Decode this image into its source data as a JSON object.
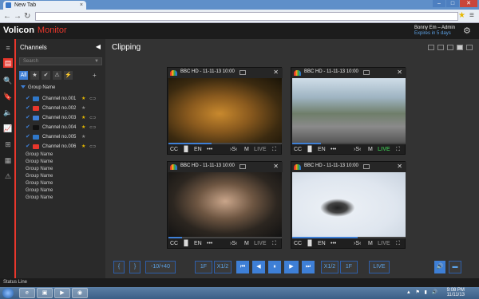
{
  "browser": {
    "tab_title": "New Tab",
    "tab_close": "×",
    "win_min": "–",
    "win_max": "□",
    "win_close": "✕",
    "back": "←",
    "forward": "→",
    "reload": "↻",
    "star_icon": "★",
    "menu_icon": "≡",
    "url": ""
  },
  "app": {
    "brand": "Volicon",
    "product": "Monitor",
    "user_name": "Bonny Em – Admin",
    "user_expiry": "Expires in 5 days",
    "settings_icon": "gear-icon",
    "accent": "#e8372c",
    "blue": "#3e7fd6"
  },
  "leftbar": {
    "items": [
      {
        "icon": "≡"
      },
      {
        "icon": "▤"
      },
      {
        "icon": "🔍"
      },
      {
        "icon": "🔖"
      },
      {
        "icon": "🔈"
      },
      {
        "icon": "📈"
      },
      {
        "icon": "⊞"
      },
      {
        "icon": "▦"
      },
      {
        "icon": "⚠"
      }
    ]
  },
  "channels": {
    "title": "Channels",
    "collapse": "◀",
    "search_placeholder": "Search",
    "filter_icon": "▼",
    "filters": [
      "All",
      "★",
      "✔",
      "⚠",
      "⚡"
    ],
    "add_group": "+",
    "group_top": "Group Name",
    "rows": [
      {
        "name": "Channel no.001",
        "logo": "#2f77c8",
        "star": "★",
        "star_color": "#e6b800",
        "extra": "⊂⊃"
      },
      {
        "name": "Channel no.002",
        "logo": "#e8372c",
        "star": "★",
        "star_color": "#888",
        "extra": ""
      },
      {
        "name": "Channel no.003",
        "logo": "#3e7fd6",
        "star": "★",
        "star_color": "#e6b800",
        "extra": "⊂⊃"
      },
      {
        "name": "Channel no.004",
        "logo": "#111111",
        "star": "★",
        "star_color": "#e6b800",
        "extra": "⊂⊃"
      },
      {
        "name": "Channel no.005",
        "logo": "#2f77c8",
        "star": "★",
        "star_color": "#888",
        "extra": ""
      },
      {
        "name": "Channel no.006",
        "logo": "#e8372c",
        "star": "★",
        "star_color": "#e6b800",
        "extra": "⊂⊃"
      }
    ],
    "groups": [
      "Group Name",
      "Group Name",
      "Group Name",
      "Group Name",
      "Group Name",
      "Group Name",
      "Group Name"
    ]
  },
  "main": {
    "title": "Clipping"
  },
  "players": [
    {
      "label": "BBC HD - 11-11-13 10:00",
      "progress": 0.38,
      "live": "LIVE",
      "live_on": false
    },
    {
      "label": "BBC HD - 11-11-13 10:00",
      "progress": 0.25,
      "live": "LIVE",
      "live_on": true
    },
    {
      "label": "BBC HD - 11-11-13 10:00",
      "progress": 0.12,
      "live": "LIVE",
      "live_on": false
    },
    {
      "label": "BBC HD - 11-11-13 10:00",
      "progress": 0.58,
      "live": "LIVE",
      "live_on": false
    }
  ],
  "player_footer": {
    "cc": "CC",
    "bars": "▐▌",
    "en": "EN",
    "dots": "•••",
    "skip": "›S‹",
    "m": "M",
    "fullscreen": "⛶",
    "close": "✕",
    "pip": "▭"
  },
  "controls": {
    "mark_in": "{",
    "mark_out": "}",
    "offset": "-10/+40",
    "b1": "1F",
    "b2": "X1/2",
    "b3": "⏮",
    "b4": "◀",
    "b5": "⏸",
    "b6": "▶",
    "b7": "⏭",
    "b8": "X1/2",
    "b9": "1F",
    "live": "LIVE",
    "vol": "🔊",
    "screen": "▬"
  },
  "status": {
    "text": "Status Line"
  },
  "taskbar": {
    "time": "9:08 PM",
    "date": "11/11/13",
    "tray": "▲ ⚑ ▮ 🔊"
  }
}
